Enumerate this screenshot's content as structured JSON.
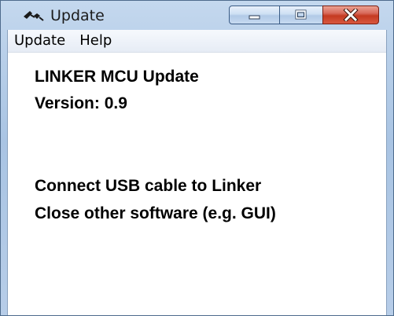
{
  "window": {
    "title": "Update",
    "title_icon": "satellite-icon",
    "controls": {
      "minimize_icon": "minimize-icon",
      "maximize_icon": "maximize-icon",
      "close_icon": "close-icon"
    }
  },
  "menu": {
    "items": [
      "Update",
      "Help"
    ]
  },
  "content": {
    "product_name": "LINKER MCU Update",
    "version": "Version: 0.9",
    "instruction_1": "Connect USB cable to Linker",
    "instruction_2": "Close other software (e.g. GUI)"
  },
  "colors": {
    "frame": "#b8cfe9",
    "close_button": "#c43a21",
    "text": "#000000"
  }
}
